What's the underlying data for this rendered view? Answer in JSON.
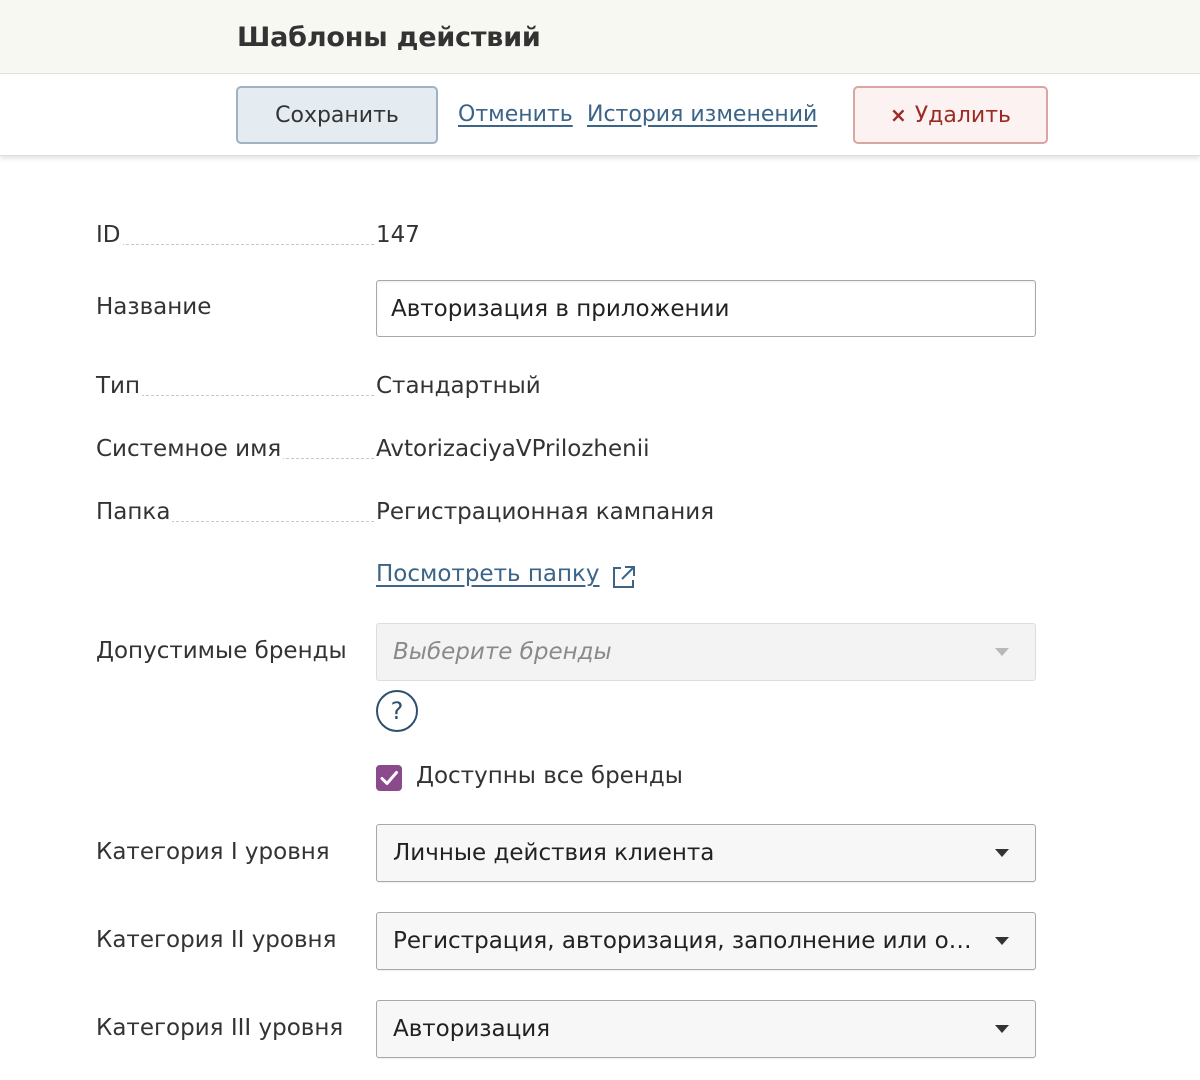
{
  "header": {
    "title": "Шаблоны действий"
  },
  "toolbar": {
    "save_label": "Сохранить",
    "cancel_label": "Отменить",
    "history_label": "История изменений",
    "delete_icon": "×",
    "delete_label": "Удалить"
  },
  "form": {
    "id": {
      "label": "ID",
      "value": "147"
    },
    "name": {
      "label": "Название",
      "value": "Авторизация в приложении"
    },
    "type": {
      "label": "Тип",
      "value": "Стандартный"
    },
    "system_name": {
      "label": "Системное имя",
      "value": "AvtorizaciyaVPrilozhenii"
    },
    "folder": {
      "label": "Папка",
      "value": "Регистрационная кампания",
      "view_link": "Посмотреть папку"
    },
    "brands": {
      "label": "Допустимые бренды",
      "placeholder": "Выберите бренды",
      "help_glyph": "?",
      "all_brands_label": "Доступны все бренды",
      "all_brands_checked": true
    },
    "category1": {
      "label": "Категория I уровня",
      "value": "Личные действия клиента"
    },
    "category2": {
      "label": "Категория II уровня",
      "value": "Регистрация, авторизация, заполнение или обновление анкеты"
    },
    "category3": {
      "label": "Категория III уровня",
      "value": "Авторизация"
    }
  },
  "colors": {
    "link": "#3b6488",
    "danger": "#9b2a22",
    "checkbox": "#8a4a8c"
  },
  "icons": [
    "close-icon",
    "external-link-icon",
    "help-icon",
    "check-icon",
    "chevron-down-icon"
  ]
}
